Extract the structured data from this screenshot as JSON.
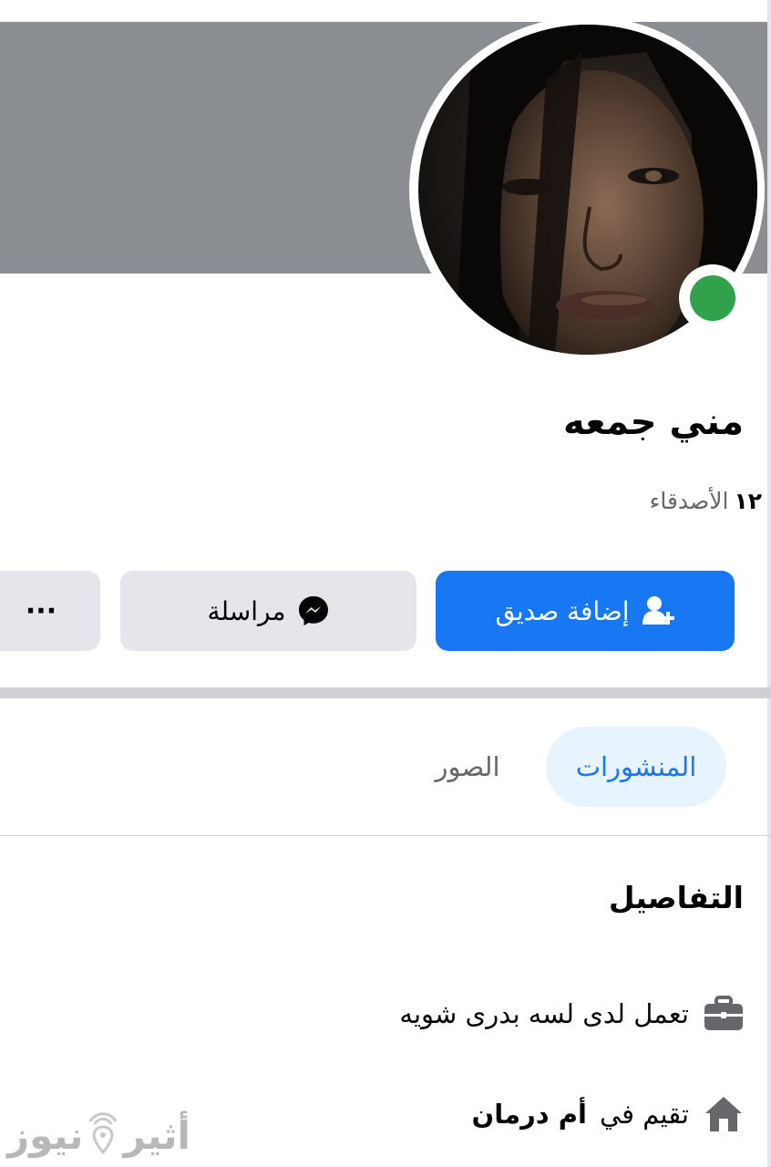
{
  "profile": {
    "name": "مني جمعه",
    "friends_count": "١٢",
    "friends_label": "الأصدقاء",
    "online": true
  },
  "actions": {
    "add_friend_label": "إضافة صديق",
    "message_label": "مراسلة",
    "more_label": "···"
  },
  "tabs": [
    {
      "label": "المنشورات",
      "active": true
    },
    {
      "label": "الصور",
      "active": false
    }
  ],
  "details": {
    "title": "التفاصيل",
    "work_text": "تعمل لدى لسه بدرى شويه",
    "lives_prefix": "تقيم في",
    "lives_place": "أم درمان"
  },
  "watermark": {
    "part1": "أثير",
    "part2": "نيوز"
  },
  "colors": {
    "accent": "#1877f2",
    "online": "#31a24c",
    "cover": "#8a8d91",
    "button_gray": "#e4e6eb",
    "tab_active_bg": "#e7f3ff"
  },
  "icons": {
    "add_friend": "user-plus-icon",
    "message": "messenger-icon",
    "work": "briefcase-icon",
    "home": "house-icon",
    "watermark": "signal-pin-icon"
  }
}
